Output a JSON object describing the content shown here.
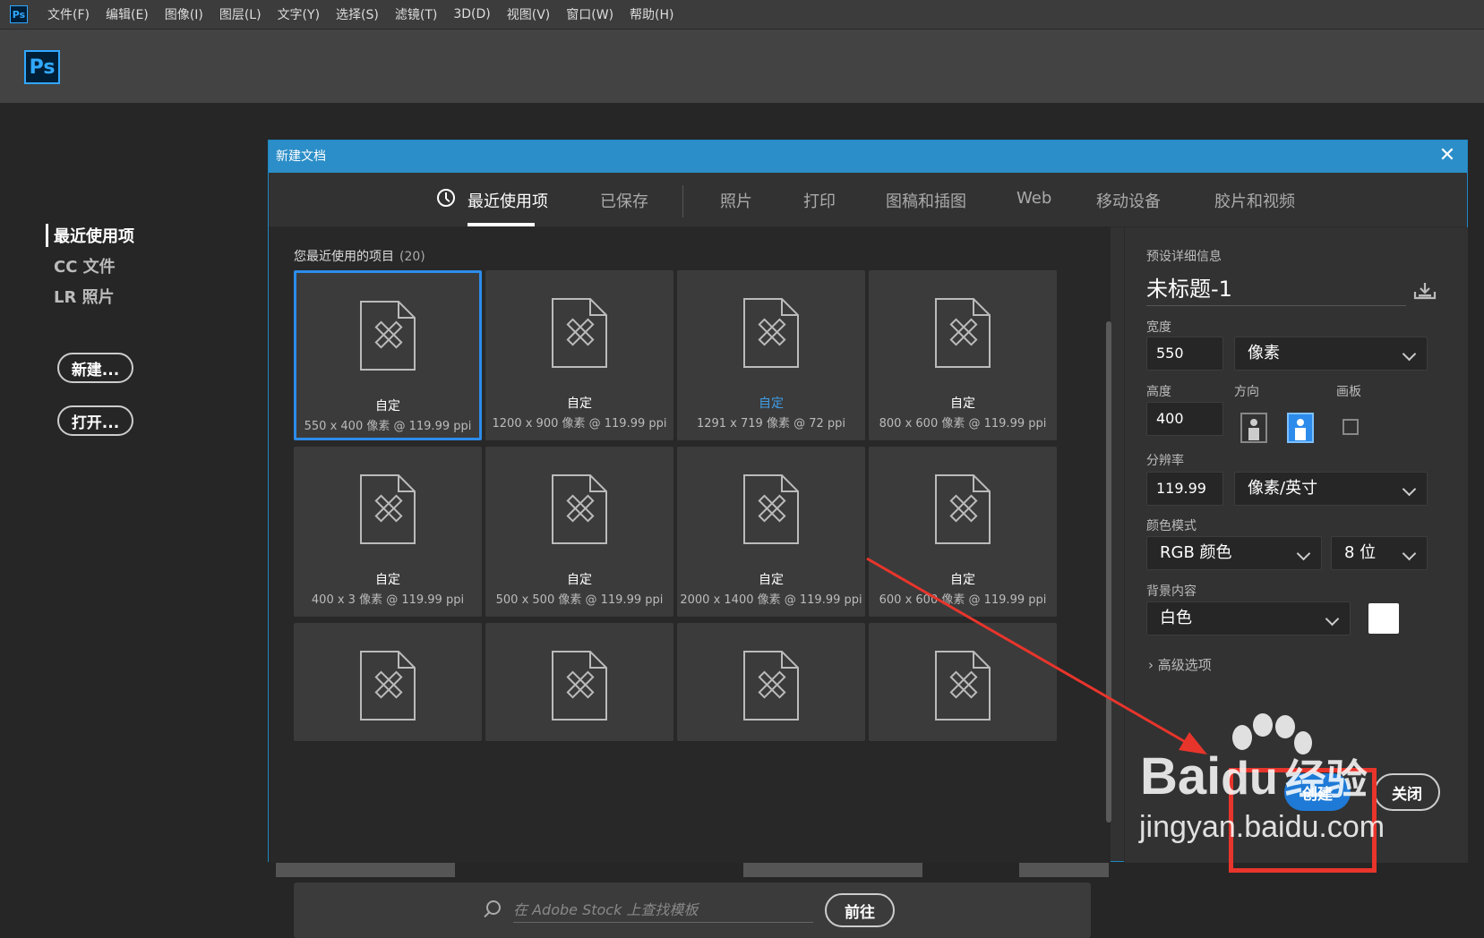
{
  "menubar": {
    "logo": "Ps",
    "items": [
      "文件(F)",
      "编辑(E)",
      "图像(I)",
      "图层(L)",
      "文字(Y)",
      "选择(S)",
      "滤镜(T)",
      "3D(D)",
      "视图(V)",
      "窗口(W)",
      "帮助(H)"
    ]
  },
  "toolbar": {
    "logo": "Ps"
  },
  "home": {
    "nav": [
      "最近使用项",
      "CC 文件",
      "LR 照片"
    ],
    "new_button": "新建...",
    "open_button": "打开..."
  },
  "dialog": {
    "title": "新建文档",
    "close": "✕",
    "tabs": [
      "最近使用项",
      "已保存",
      "照片",
      "打印",
      "图稿和插图",
      "Web",
      "移动设备",
      "胶片和视频"
    ],
    "recent_label": "您最近使用的项目",
    "recent_count": "(20)",
    "cards": [
      {
        "name": "自定",
        "meta": "550 x 400 像素 @ 119.99 ppi"
      },
      {
        "name": "自定",
        "meta": "1200 x 900 像素 @ 119.99 ppi"
      },
      {
        "name": "自定",
        "meta": "1291 x 719 像素 @ 72 ppi"
      },
      {
        "name": "自定",
        "meta": "800 x 600 像素 @ 119.99 ppi"
      },
      {
        "name": "自定",
        "meta": "400 x 3 像素 @ 119.99 ppi"
      },
      {
        "name": "自定",
        "meta": "500 x 500 像素 @ 119.99 ppi"
      },
      {
        "name": "自定",
        "meta": "2000 x 1400 像素 @ 119.99 ppi"
      },
      {
        "name": "自定",
        "meta": "600 x 600 像素 @ 119.99 ppi"
      },
      {
        "name": "",
        "meta": ""
      },
      {
        "name": "",
        "meta": ""
      },
      {
        "name": "",
        "meta": ""
      },
      {
        "name": "",
        "meta": ""
      }
    ],
    "stock_placeholder": "在 Adobe Stock 上查找模板",
    "stock_button": "前往",
    "details": {
      "heading": "预设详细信息",
      "doc_name": "未标题-1",
      "width_label": "宽度",
      "width_value": "550",
      "width_unit": "像素",
      "height_label": "高度",
      "height_value": "400",
      "orientation_label": "方向",
      "artboard_label": "画板",
      "resolution_label": "分辨率",
      "resolution_value": "119.99",
      "resolution_unit": "像素/英寸",
      "color_mode_label": "颜色模式",
      "color_mode": "RGB 颜色",
      "bit_depth": "8 位",
      "background_label": "背景内容",
      "background": "白色",
      "advanced": "高级选项",
      "create_button": "创建",
      "close_button": "关闭"
    }
  },
  "watermark": {
    "brand": "Bai",
    "brand2": "du",
    "cn": "经验",
    "url": "jingyan.baidu.com"
  },
  "colors": {
    "accent": "#2d8ceb",
    "title_bar": "#2b8ec8",
    "annotation": "#e8352c"
  }
}
